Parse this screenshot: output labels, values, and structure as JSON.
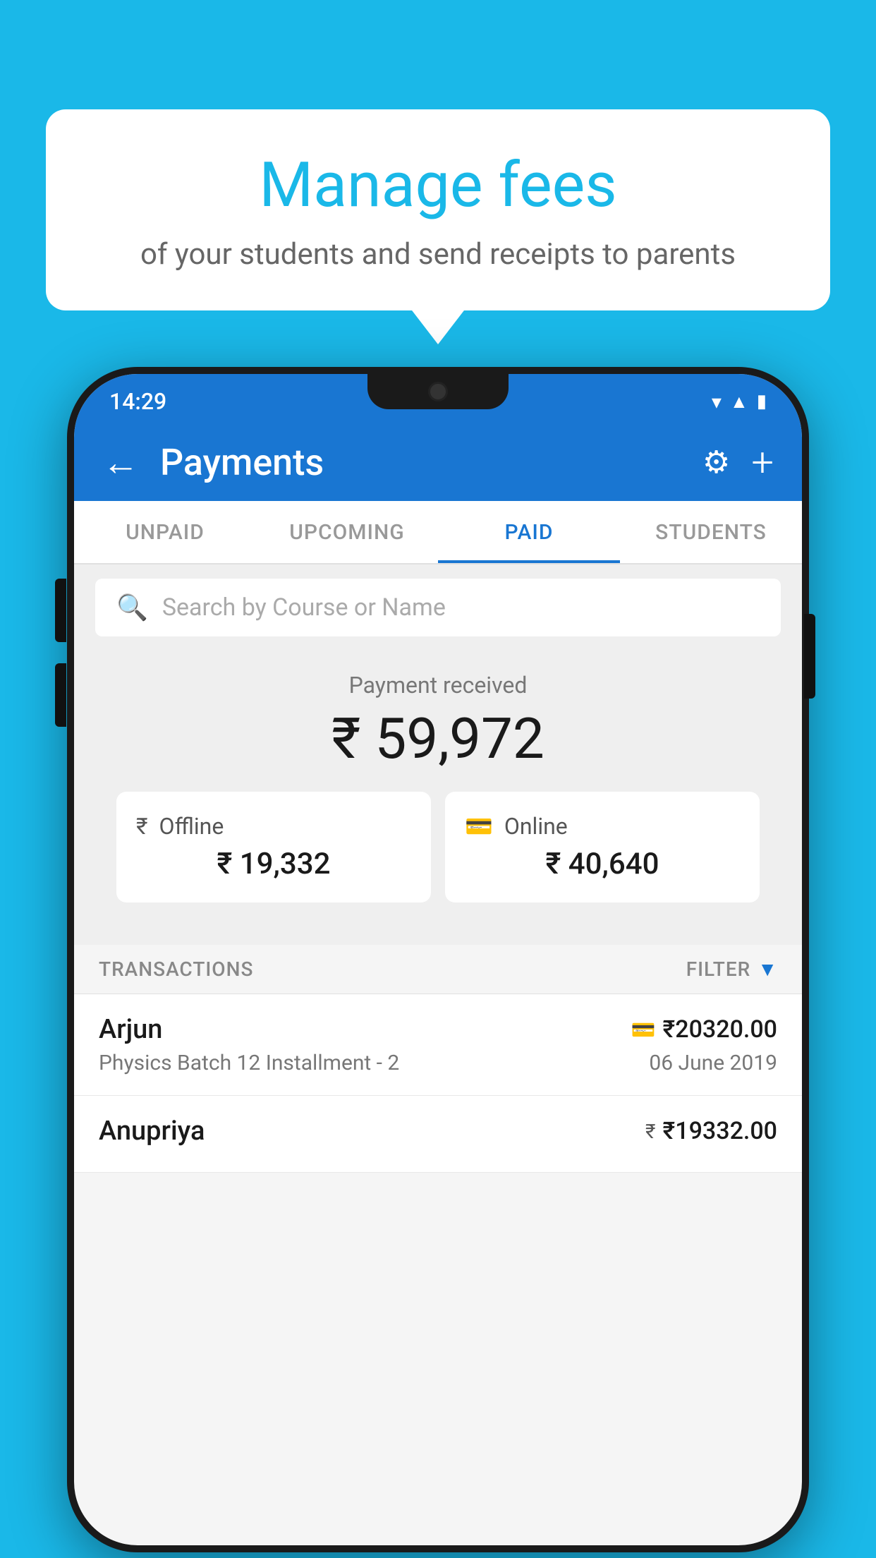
{
  "background_color": "#1ab8e8",
  "speech_bubble": {
    "title": "Manage fees",
    "subtitle": "of your students and send receipts to parents"
  },
  "phone": {
    "status_bar": {
      "time": "14:29",
      "wifi": "▼",
      "signal": "▲",
      "battery": "▮"
    },
    "app_bar": {
      "title": "Payments",
      "back_label": "←",
      "settings_label": "⚙",
      "add_label": "+"
    },
    "tabs": [
      {
        "label": "UNPAID",
        "active": false
      },
      {
        "label": "UPCOMING",
        "active": false
      },
      {
        "label": "PAID",
        "active": true
      },
      {
        "label": "STUDENTS",
        "active": false
      }
    ],
    "search": {
      "placeholder": "Search by Course or Name"
    },
    "summary": {
      "label": "Payment received",
      "amount": "₹ 59,972",
      "offline": {
        "label": "Offline",
        "amount": "₹ 19,332"
      },
      "online": {
        "label": "Online",
        "amount": "₹ 40,640"
      }
    },
    "transactions_section": {
      "label": "TRANSACTIONS",
      "filter_label": "FILTER"
    },
    "transactions": [
      {
        "name": "Arjun",
        "payment_type": "card",
        "amount": "₹20320.00",
        "course": "Physics Batch 12 Installment - 2",
        "date": "06 June 2019"
      },
      {
        "name": "Anupriya",
        "payment_type": "cash",
        "amount": "₹19332.00",
        "course": "",
        "date": ""
      }
    ]
  }
}
